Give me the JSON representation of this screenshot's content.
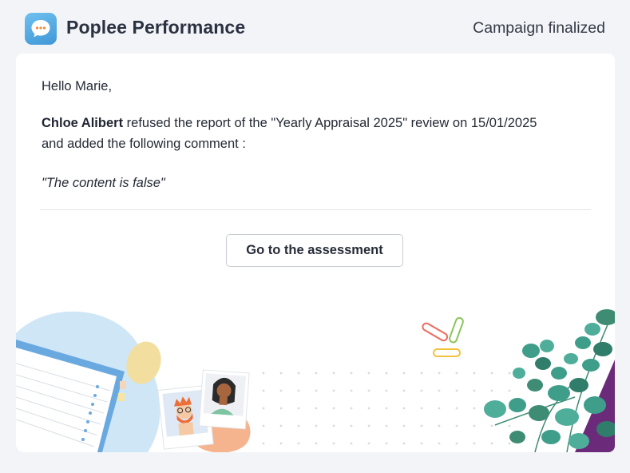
{
  "header": {
    "app_name": "Poplee Performance",
    "status": "Campaign finalized",
    "logo_icon": "chat-bubble-icon"
  },
  "email": {
    "greeting": "Hello Marie,",
    "sender_name": "Chloe Alibert",
    "message_line1": " refused the report of the \"Yearly Appraisal 2025\" review on 15/01/2025",
    "message_line2": "and added the following comment :",
    "comment": "\"The content is false\"",
    "cta_label": "Go to the assessment"
  },
  "colors": {
    "brand_blue": "#4aa3df",
    "page_background": "#f3f4f8",
    "card_background": "#ffffff",
    "plant_green": "#3f9e8a"
  },
  "illustration": {
    "items": [
      "notebook",
      "avatar-photos",
      "paper-clips",
      "plant-leaves",
      "dot-grid"
    ]
  }
}
